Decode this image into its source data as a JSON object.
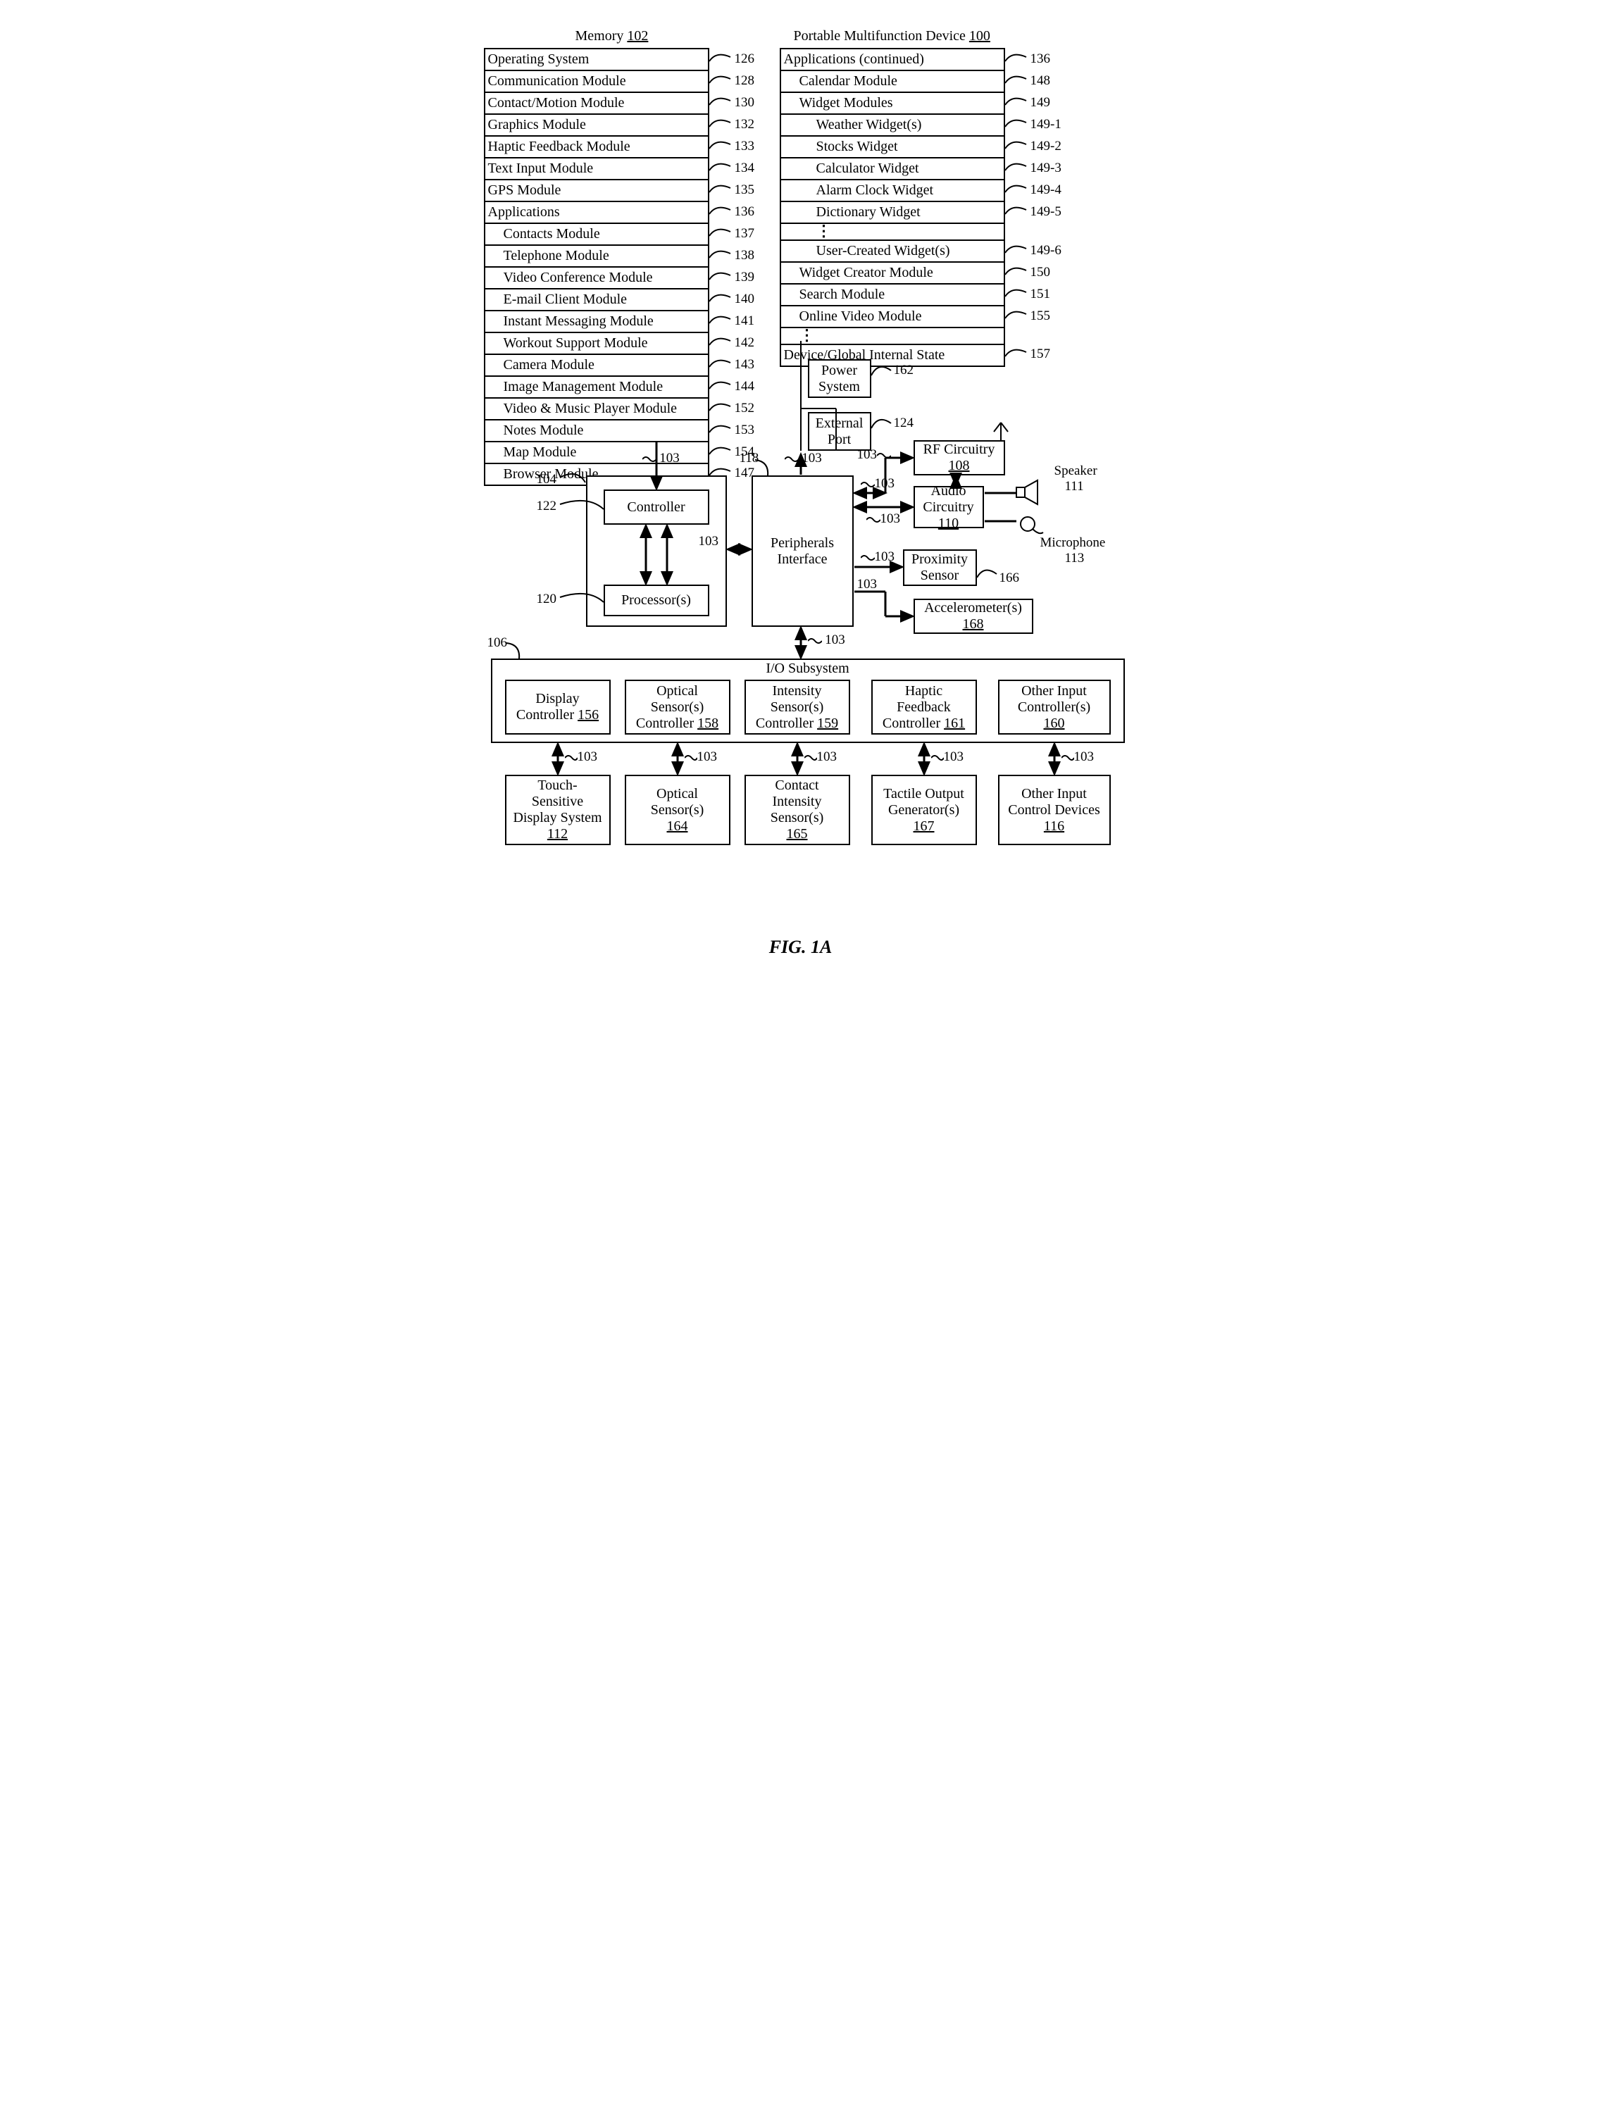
{
  "title_memory": "Memory",
  "title_memory_ref": "102",
  "title_device": "Portable Multifunction Device",
  "title_device_ref": "100",
  "figure_caption": "FIG. 1A",
  "memory_rows": [
    {
      "label": "Operating System",
      "ref": "126",
      "indent": 0
    },
    {
      "label": "Communication Module",
      "ref": "128",
      "indent": 0
    },
    {
      "label": "Contact/Motion Module",
      "ref": "130",
      "indent": 0
    },
    {
      "label": "Graphics Module",
      "ref": "132",
      "indent": 0
    },
    {
      "label": "Haptic Feedback Module",
      "ref": "133",
      "indent": 0
    },
    {
      "label": "Text Input Module",
      "ref": "134",
      "indent": 0
    },
    {
      "label": "GPS Module",
      "ref": "135",
      "indent": 0
    },
    {
      "label": "Applications",
      "ref": "136",
      "indent": 0
    },
    {
      "label": "Contacts Module",
      "ref": "137",
      "indent": 1
    },
    {
      "label": "Telephone Module",
      "ref": "138",
      "indent": 1
    },
    {
      "label": "Video Conference Module",
      "ref": "139",
      "indent": 1
    },
    {
      "label": "E-mail Client Module",
      "ref": "140",
      "indent": 1
    },
    {
      "label": "Instant Messaging Module",
      "ref": "141",
      "indent": 1
    },
    {
      "label": "Workout Support Module",
      "ref": "142",
      "indent": 1
    },
    {
      "label": "Camera Module",
      "ref": "143",
      "indent": 1
    },
    {
      "label": "Image Management Module",
      "ref": "144",
      "indent": 1
    },
    {
      "label": "Video & Music Player Module",
      "ref": "152",
      "indent": 1
    },
    {
      "label": "Notes Module",
      "ref": "153",
      "indent": 1
    },
    {
      "label": "Map Module",
      "ref": "154",
      "indent": 1
    },
    {
      "label": "Browser Module",
      "ref": "147",
      "indent": 1
    }
  ],
  "apps_cont_rows": [
    {
      "label": "Applications (continued)",
      "ref": "136",
      "indent": 0
    },
    {
      "label": "Calendar Module",
      "ref": "148",
      "indent": 1
    },
    {
      "label": "Widget Modules",
      "ref": "149",
      "indent": 1
    },
    {
      "label": "Weather Widget(s)",
      "ref": "149-1",
      "indent": 2
    },
    {
      "label": "Stocks Widget",
      "ref": "149-2",
      "indent": 2
    },
    {
      "label": "Calculator Widget",
      "ref": "149-3",
      "indent": 2
    },
    {
      "label": "Alarm Clock Widget",
      "ref": "149-4",
      "indent": 2
    },
    {
      "label": "Dictionary Widget",
      "ref": "149-5",
      "indent": 2
    },
    {
      "label": "DOTS",
      "ref": "",
      "indent": 2,
      "dots": true
    },
    {
      "label": "User-Created Widget(s)",
      "ref": "149-6",
      "indent": 2
    },
    {
      "label": "Widget Creator Module",
      "ref": "150",
      "indent": 1
    },
    {
      "label": "Search Module",
      "ref": "151",
      "indent": 1
    },
    {
      "label": "Online Video Module",
      "ref": "155",
      "indent": 1
    },
    {
      "label": "DOTS",
      "ref": "",
      "indent": 1,
      "dots": true
    },
    {
      "label": "Device/Global Internal State",
      "ref": "157",
      "indent": 0
    }
  ],
  "blocks": {
    "power_system": "Power\nSystem",
    "power_system_ref": "162",
    "external_port": "External\nPort",
    "external_port_ref": "124",
    "rf_circuitry": "RF Circuitry",
    "rf_circuitry_ref": "108",
    "audio_circuitry": "Audio\nCircuitry",
    "audio_circuitry_ref": "110",
    "proximity_sensor": "Proximity\nSensor",
    "proximity_sensor_ref": "166",
    "accelerometer": "Accelerometer(s)",
    "accelerometer_ref": "168",
    "controller": "Controller",
    "controller_ref_outer": "104",
    "controller_ref_inner": "122",
    "processors": "Processor(s)",
    "processors_ref": "120",
    "peripherals": "Peripherals\nInterface",
    "peripherals_ref": "118",
    "io_subsystem": "I/O Subsystem",
    "io_subsystem_ref": "106",
    "display_controller": "Display\nController",
    "display_controller_ref": "156",
    "optical_ctrl": "Optical\nSensor(s)\nController",
    "optical_ctrl_ref": "158",
    "intensity_ctrl": "Intensity\nSensor(s)\nController",
    "intensity_ctrl_ref": "159",
    "haptic_ctrl": "Haptic\nFeedback\nController",
    "haptic_ctrl_ref": "161",
    "other_ctrl": "Other Input\nController(s)",
    "other_ctrl_ref": "160",
    "touch_display": "Touch-\nSensitive\nDisplay System",
    "touch_display_ref": "112",
    "optical_sensors": "Optical\nSensor(s)",
    "optical_sensors_ref": "164",
    "contact_intensity": "Contact\nIntensity\nSensor(s)",
    "contact_intensity_ref": "165",
    "tactile_output": "Tactile Output\nGenerator(s)",
    "tactile_output_ref": "167",
    "other_input": "Other Input\nControl Devices",
    "other_input_ref": "116",
    "speaker": "Speaker",
    "speaker_ref": "111",
    "microphone": "Microphone",
    "microphone_ref": "113",
    "bus_ref": "103"
  }
}
